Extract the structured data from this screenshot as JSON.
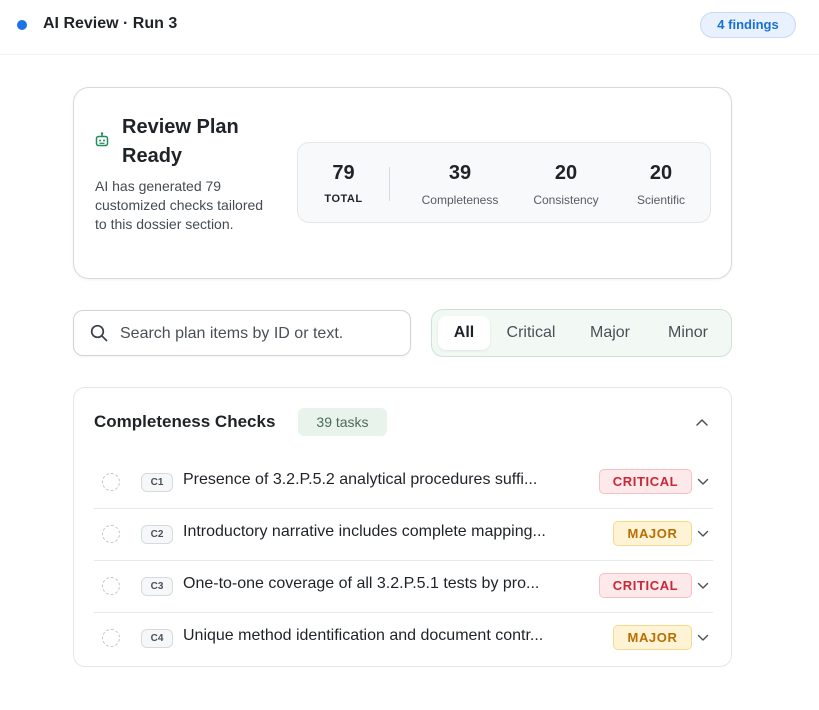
{
  "header": {
    "run_title": "AI Review · Run 3",
    "findings_badge": "4 findings",
    "status_color": "#1a73e8"
  },
  "plan": {
    "title": "Review Plan Ready",
    "description": "AI has generated 79 customized checks tailored to this dossier section.",
    "icon": "robot-icon",
    "stats": {
      "total": {
        "value": "79",
        "label": "TOTAL"
      },
      "completeness": {
        "value": "39",
        "label": "Completeness"
      },
      "consistency": {
        "value": "20",
        "label": "Consistency"
      },
      "scientific": {
        "value": "20",
        "label": "Scientific"
      }
    }
  },
  "search": {
    "placeholder": "Search plan items by ID or text.",
    "value": ""
  },
  "filters": [
    "All",
    "Critical",
    "Major",
    "Minor"
  ],
  "active_filter": "All",
  "section": {
    "title": "Completeness Checks",
    "count_label": "39 tasks",
    "expanded": true,
    "rows": [
      {
        "id": "C1",
        "text": "Presence of 3.2.P.5.2 analytical procedures suffi...",
        "severity": "CRITICAL"
      },
      {
        "id": "C2",
        "text": "Introductory narrative includes complete mapping...",
        "severity": "MAJOR"
      },
      {
        "id": "C3",
        "text": "One-to-one coverage of all 3.2.P.5.1 tests by pro...",
        "severity": "CRITICAL"
      },
      {
        "id": "C4",
        "text": "Unique method identification and document contr...",
        "severity": "MAJOR"
      }
    ]
  },
  "colors": {
    "critical": "#c8283a",
    "major": "#b86e00",
    "accent_green": "#4d6b57"
  }
}
